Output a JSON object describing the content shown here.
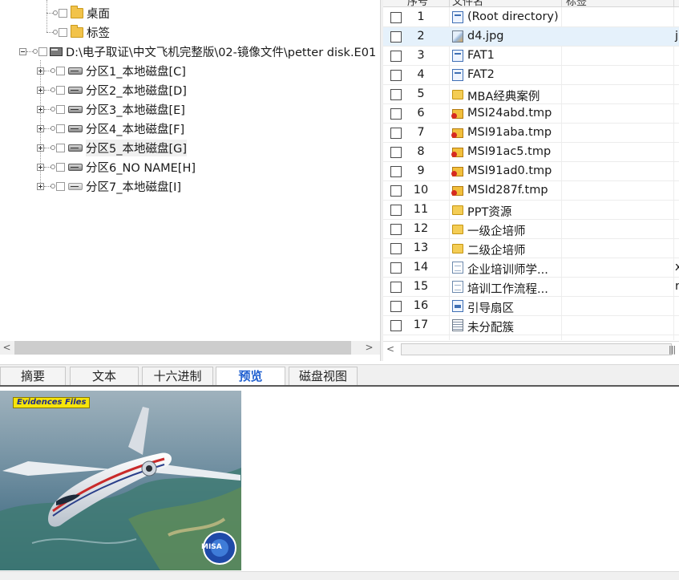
{
  "tree": {
    "items": [
      {
        "label": "桌面"
      },
      {
        "label": "标签"
      },
      {
        "label": "D:\\电子取证\\中文飞机完整版\\02-镜像文件\\petter disk.E01"
      },
      {
        "label": "分区1_本地磁盘[C]"
      },
      {
        "label": "分区2_本地磁盘[D]"
      },
      {
        "label": "分区3_本地磁盘[E]"
      },
      {
        "label": "分区4_本地磁盘[F]"
      },
      {
        "label": "分区5_本地磁盘[G]"
      },
      {
        "label": "分区6_NO NAME[H]"
      },
      {
        "label": "分区7_本地磁盘[I]"
      }
    ],
    "scroll_left": "<",
    "scroll_right": ">"
  },
  "list": {
    "columns": {
      "num": "序号",
      "name": "文件名",
      "tag": "标签"
    },
    "rows": [
      {
        "num": "1",
        "name": "(Root directory)",
        "icon": "system-file-icon",
        "extra": ""
      },
      {
        "num": "2",
        "name": "d4.jpg",
        "icon": "image-file-icon",
        "extra": "j"
      },
      {
        "num": "3",
        "name": "FAT1",
        "icon": "system-file-icon",
        "extra": ""
      },
      {
        "num": "4",
        "name": "FAT2",
        "icon": "system-file-icon",
        "extra": ""
      },
      {
        "num": "5",
        "name": "MBA经典案例",
        "icon": "folder-icon",
        "extra": ""
      },
      {
        "num": "6",
        "name": "MSI24abd.tmp",
        "icon": "deleted-tmp-icon",
        "extra": ""
      },
      {
        "num": "7",
        "name": "MSI91aba.tmp",
        "icon": "deleted-tmp-icon",
        "extra": ""
      },
      {
        "num": "8",
        "name": "MSI91ac5.tmp",
        "icon": "deleted-tmp-icon",
        "extra": ""
      },
      {
        "num": "9",
        "name": "MSI91ad0.tmp",
        "icon": "deleted-tmp-icon",
        "extra": ""
      },
      {
        "num": "10",
        "name": "MSId287f.tmp",
        "icon": "deleted-tmp-icon",
        "extra": ""
      },
      {
        "num": "11",
        "name": "PPT资源",
        "icon": "folder-icon",
        "extra": ""
      },
      {
        "num": "12",
        "name": "一级企培师",
        "icon": "folder-icon",
        "extra": ""
      },
      {
        "num": "13",
        "name": "二级企培师",
        "icon": "folder-icon",
        "extra": ""
      },
      {
        "num": "14",
        "name": "企业培训师学...",
        "icon": "document-icon",
        "extra": "x"
      },
      {
        "num": "15",
        "name": "培训工作流程...",
        "icon": "document-icon",
        "extra": "r"
      },
      {
        "num": "16",
        "name": "引导扇区",
        "icon": "boot-sector-icon",
        "extra": ""
      },
      {
        "num": "17",
        "name": "未分配簇",
        "icon": "unallocated-icon",
        "extra": ""
      }
    ],
    "scroll_left": "<",
    "grip": "|||"
  },
  "tabs": [
    {
      "label": "摘要",
      "active": false
    },
    {
      "label": "文本",
      "active": false
    },
    {
      "label": "十六进制",
      "active": false
    },
    {
      "label": "预览",
      "active": true
    },
    {
      "label": "磁盘视图",
      "active": false
    }
  ],
  "preview": {
    "badge": "Evidences Files",
    "image": "airplane-photo",
    "logo_text": "MISA"
  },
  "colors": {
    "accent": "#1f5fd0",
    "selected_row": "#e5f1fb",
    "badge": "#f6e40a"
  }
}
